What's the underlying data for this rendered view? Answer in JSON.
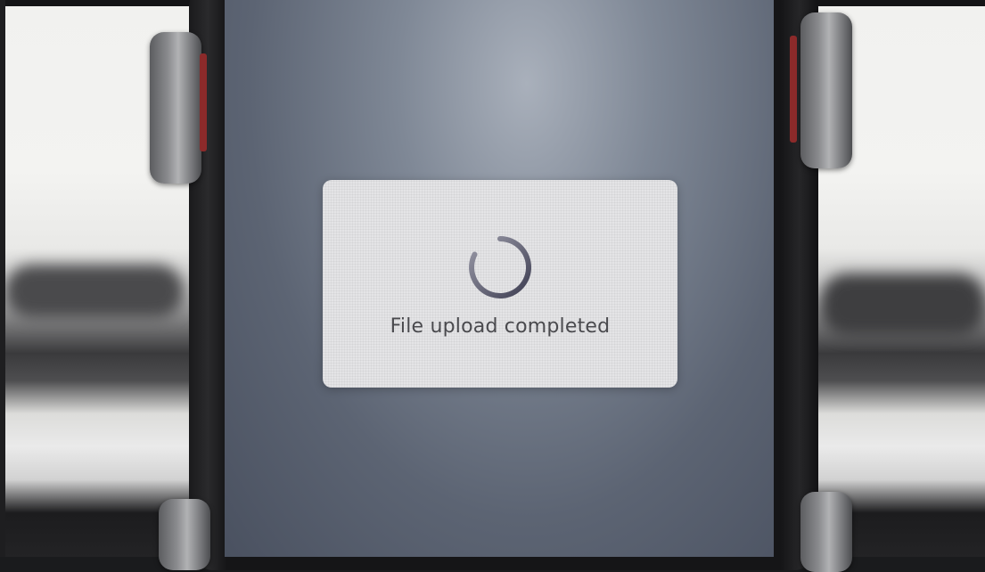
{
  "dialog": {
    "message": "File upload completed",
    "spinner_icon": "loading-spinner-icon"
  },
  "colors": {
    "dialog_background": "#e4e4e6",
    "message_text": "#4a4a4e",
    "spinner_stroke": "#55556a",
    "screen": "#6a7382",
    "phone_body": "#151517",
    "clamp": "#8a8b8e",
    "clamp_accent": "#8c2a2a"
  }
}
